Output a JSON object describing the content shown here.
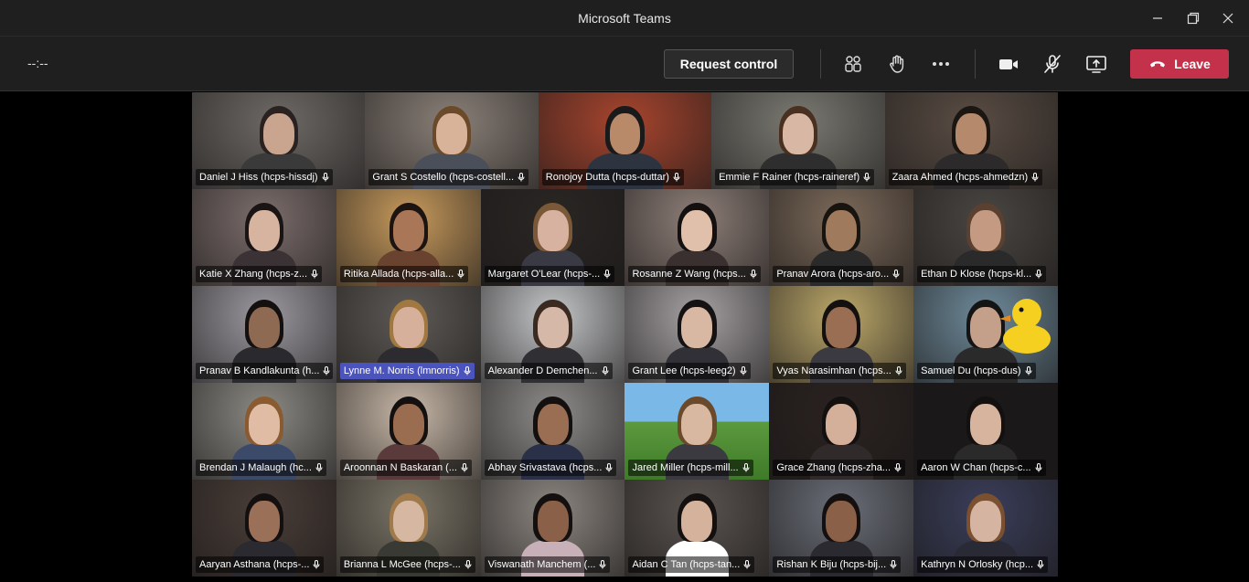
{
  "window": {
    "title": "Microsoft Teams"
  },
  "toolbar": {
    "timer": "--:--",
    "request_control_label": "Request control",
    "leave_label": "Leave",
    "leave_color": "#c4314b"
  },
  "participants": [
    [
      {
        "name": "Daniel J Hiss (hcps-hissdj)",
        "bg": "#6e6a66",
        "skin": "#c9a58f",
        "shirt": "#3a3a3a",
        "hair": "#2a2220"
      },
      {
        "name": "Grant S Costello (hcps-costell...",
        "bg": "#8a8078",
        "skin": "#d9b29a",
        "shirt": "#4a4f5a",
        "hair": "#6b4a2a"
      },
      {
        "name": "Ronojoy Dutta (hcps-duttar)",
        "bg": "#a8452e",
        "skin": "#b98a6a",
        "shirt": "#2d3440",
        "hair": "#1a1a1a"
      },
      {
        "name": "Emmie F Rainer (hcps-raineref)",
        "bg": "#7a7a72",
        "skin": "#d8b8a4",
        "shirt": "#2e2e2e",
        "hair": "#4a3020"
      },
      {
        "name": "Zaara Ahmed (hcps-ahmedzn)",
        "bg": "#5a4d44",
        "skin": "#b58a6c",
        "shirt": "#2c2a2a",
        "hair": "#1c1612"
      }
    ],
    [
      {
        "name": "Katie X Zhang (hcps-z...",
        "bg": "#7c6e6c",
        "skin": "#d6b4a0",
        "shirt": "#3b3236",
        "hair": "#1a1414"
      },
      {
        "name": "Ritika Allada (hcps-alla...",
        "bg": "#c79a5c",
        "skin": "#a97658",
        "shirt": "#6a4230",
        "hair": "#1c1410"
      },
      {
        "name": "Margaret O'Lear (hcps-...",
        "bg": "#2a2624",
        "skin": "#d8b2a0",
        "shirt": "#3a3a44",
        "hair": "#7a5838"
      },
      {
        "name": "Rosanne Z Wang (hcps...",
        "bg": "#8e7f78",
        "skin": "#e0c0aa",
        "shirt": "#3a3030",
        "hair": "#141010"
      },
      {
        "name": "Pranav Arora (hcps-aro...",
        "bg": "#7c6a5a",
        "skin": "#a07a5c",
        "shirt": "#2a2a2a",
        "hair": "#181410"
      },
      {
        "name": "Ethan D Klose (hcps-kl...",
        "bg": "#4a4642",
        "skin": "#c49a82",
        "shirt": "#2a2a2a",
        "hair": "#5a4030"
      }
    ],
    [
      {
        "name": "Pranav B Kandlakunta (h...",
        "bg": "#9c9aa0",
        "skin": "#8e6a52",
        "shirt": "#2a2a2e",
        "hair": "#141010"
      },
      {
        "name": "Lynne M. Norris (lmnorris)",
        "bg": "#5e5a56",
        "skin": "#d6b09a",
        "shirt": "#2c2c30",
        "hair": "#a07840",
        "active": true
      },
      {
        "name": "Alexander D Demchen...",
        "bg": "#c4c6c8",
        "skin": "#d6b8a8",
        "shirt": "#303034",
        "hair": "#3a2a20"
      },
      {
        "name": "Grant Lee (hcps-leeg2)",
        "bg": "#a6a2a4",
        "skin": "#d8b8a2",
        "shirt": "#303036",
        "hair": "#141212"
      },
      {
        "name": "Vyas Narasimhan (hcps...",
        "bg": "#bca86a",
        "skin": "#9a6e52",
        "shirt": "#3a3a40",
        "hair": "#141010"
      },
      {
        "name": "Samuel Du (hcps-dus)",
        "bg": "#6e8a9a",
        "skin": "#c4a08a",
        "shirt": "#2a2a2a",
        "hair": "#141414",
        "duck": true
      }
    ],
    [
      {
        "name": "Brendan J Malaugh (hc...",
        "bg": "#8c8a84",
        "skin": "#e0bca4",
        "shirt": "#3c4a6a",
        "hair": "#8a5a30"
      },
      {
        "name": "Aroonnan N Baskaran (...",
        "bg": "#c8b8a8",
        "skin": "#9a6c50",
        "shirt": "#5a3a3a",
        "hair": "#141010"
      },
      {
        "name": "Abhay Srivastava (hcps...",
        "bg": "#8e8c8a",
        "skin": "#9a6e52",
        "shirt": "#2a3048",
        "hair": "#141010"
      },
      {
        "name": "Jared Miller (hcps-mill...",
        "bg": "#5c9a3e",
        "skin": "#d8b8a0",
        "shirt": "#3a3a40",
        "hair": "#6a4a2a",
        "minecraft": true
      },
      {
        "name": "Grace Zhang (hcps-zha...",
        "bg": "#2a2220",
        "skin": "#d4b09a",
        "shirt": "#302a2a",
        "hair": "#141010"
      },
      {
        "name": "Aaron W Chan (hcps-c...",
        "bg": "#1a1818",
        "skin": "#d6b49e",
        "shirt": "#2a2a2a",
        "hair": "#141010"
      }
    ],
    [
      {
        "name": "Aaryan Asthana (hcps-...",
        "bg": "#4a3e38",
        "skin": "#9a7058",
        "shirt": "#2a2a30",
        "hair": "#141010"
      },
      {
        "name": "Brianna L McGee (hcps-...",
        "bg": "#7a7466",
        "skin": "#d6b8a2",
        "shirt": "#3a3a34",
        "hair": "#a07a4a"
      },
      {
        "name": "Viswanath Manchem (...",
        "bg": "#8c8680",
        "skin": "#8a6048",
        "shirt": "#c8b0b8",
        "hair": "#141010"
      },
      {
        "name": "Aidan C Tan (hcps-tan...",
        "bg": "#5a5450",
        "skin": "#d4b29c",
        "shirt": "#ffffff",
        "hair": "#141010"
      },
      {
        "name": "Rishan K Biju (hcps-bij...",
        "bg": "#6a6e78",
        "skin": "#8a6048",
        "shirt": "#2a2a30",
        "hair": "#141010"
      },
      {
        "name": "Kathryn N Orlosky (hcp...",
        "bg": "#3a3e5a",
        "skin": "#d6b4a2",
        "shirt": "#2a2a36",
        "hair": "#7a5030"
      }
    ]
  ]
}
